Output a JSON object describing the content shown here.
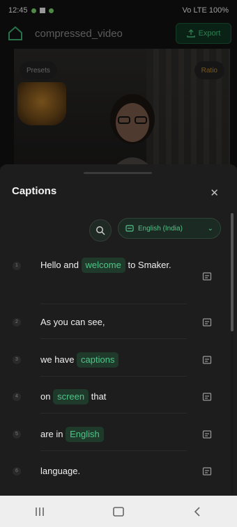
{
  "status_bar": {
    "time": "12:45",
    "right_text": "Vo LTE 100%"
  },
  "app_bar": {
    "title": "compressed_video",
    "export_label": "Export"
  },
  "preview": {
    "left_chip": "Presets",
    "right_chip": "Ratio"
  },
  "captions_sheet": {
    "title": "Captions",
    "language_label": "English (India)",
    "rows": [
      {
        "index": "1",
        "parts": [
          {
            "text": "Hello and ",
            "hl": false
          },
          {
            "text": "welcome",
            "hl": true
          },
          {
            "text": " to Smaker.",
            "hl": false
          }
        ]
      },
      {
        "index": "2",
        "parts": [
          {
            "text": "As you can see,",
            "hl": false
          }
        ]
      },
      {
        "index": "3",
        "parts": [
          {
            "text": "we have ",
            "hl": false
          },
          {
            "text": "captions",
            "hl": true
          }
        ]
      },
      {
        "index": "4",
        "parts": [
          {
            "text": "on ",
            "hl": false
          },
          {
            "text": "screen",
            "hl": true
          },
          {
            "text": " that",
            "hl": false
          }
        ]
      },
      {
        "index": "5",
        "parts": [
          {
            "text": "are in ",
            "hl": false
          },
          {
            "text": "English",
            "hl": true
          }
        ]
      },
      {
        "index": "6",
        "parts": [
          {
            "text": "language.",
            "hl": false
          }
        ]
      }
    ]
  },
  "colors": {
    "accent": "#4fc588",
    "sheet": "#1d1d1d",
    "navbar": "#eeeeee"
  },
  "icons": [
    "home-icon",
    "export-icon",
    "close-icon",
    "search-icon",
    "caption-icon",
    "chevron-down-icon",
    "edit-icon",
    "recents-icon",
    "home-nav-icon",
    "back-icon"
  ]
}
